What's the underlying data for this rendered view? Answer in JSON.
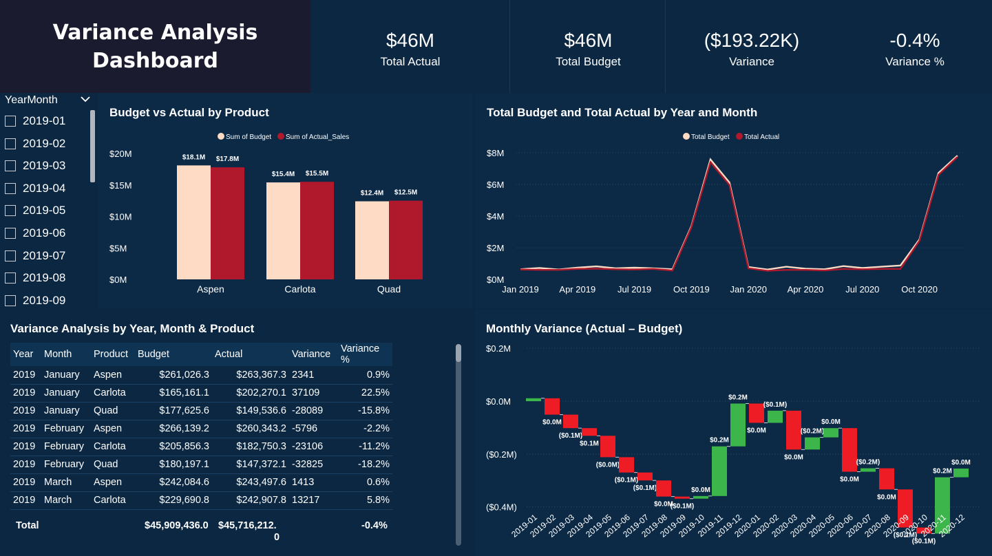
{
  "dashboard": {
    "title_line1": "Variance Analysis",
    "title_line2": "Dashboard"
  },
  "kpis": [
    {
      "value": "$46M",
      "label": "Total Actual"
    },
    {
      "value": "$46M",
      "label": "Total Budget"
    },
    {
      "value": "($193.22K)",
      "label": "Variance"
    },
    {
      "value": "-0.4%",
      "label": "Variance %"
    }
  ],
  "slicer": {
    "header": "YearMonth",
    "items": [
      "2019-01",
      "2019-02",
      "2019-03",
      "2019-04",
      "2019-05",
      "2019-06",
      "2019-07",
      "2019-08",
      "2019-09"
    ]
  },
  "colors": {
    "budget": "#fddbc5",
    "actual": "#b0182b",
    "increase": "#3cb54a",
    "decrease": "#ee1c25",
    "background": "#0b2742"
  },
  "bar_chart": {
    "title": "Budget vs Actual by Product",
    "chart_data": {
      "type": "bar",
      "categories": [
        "Aspen",
        "Carlota",
        "Quad"
      ],
      "series": [
        {
          "name": "Sum of Budget",
          "values": [
            18.1,
            15.4,
            12.4
          ],
          "labels": [
            "$18.1M",
            "$15.4M",
            "$12.4M"
          ]
        },
        {
          "name": "Sum of Actual_Sales",
          "values": [
            17.8,
            15.5,
            12.5
          ],
          "labels": [
            "$17.8M",
            "$15.5M",
            "$12.5M"
          ]
        }
      ],
      "yticks": [
        "$20M",
        "$15M",
        "$10M",
        "$5M",
        "$0M"
      ],
      "ylim": [
        0,
        20
      ],
      "legend": "top-center"
    }
  },
  "line_chart": {
    "title": "Total Budget and Total Actual by Year and Month",
    "chart_data": {
      "type": "line",
      "x": [
        "2019-01",
        "2019-02",
        "2019-03",
        "2019-04",
        "2019-05",
        "2019-06",
        "2019-07",
        "2019-08",
        "2019-09",
        "2019-10",
        "2019-11",
        "2019-12",
        "2020-01",
        "2020-02",
        "2020-03",
        "2020-04",
        "2020-05",
        "2020-06",
        "2020-07",
        "2020-08",
        "2020-09",
        "2020-10",
        "2020-11",
        "2020-12"
      ],
      "series": [
        {
          "name": "Total Budget",
          "values": [
            0.64,
            0.72,
            0.62,
            0.74,
            0.82,
            0.7,
            0.74,
            0.7,
            0.64,
            3.38,
            7.58,
            6.12,
            0.78,
            0.62,
            0.8,
            0.68,
            0.64,
            0.84,
            0.72,
            0.8,
            0.88,
            2.52,
            6.72,
            7.82
          ]
        },
        {
          "name": "Total Actual",
          "values": [
            0.62,
            0.6,
            0.6,
            0.66,
            0.68,
            0.64,
            0.62,
            0.66,
            0.56,
            3.3,
            7.4,
            5.96,
            0.7,
            0.54,
            0.6,
            0.6,
            0.56,
            0.66,
            0.64,
            0.66,
            0.66,
            2.44,
            6.6,
            7.74
          ]
        }
      ],
      "xticks": [
        "Jan 2019",
        "Apr 2019",
        "Jul 2019",
        "Oct 2019",
        "Jan 2020",
        "Apr 2020",
        "Jul 2020",
        "Oct 2020"
      ],
      "yticks": [
        "$8M",
        "$6M",
        "$4M",
        "$2M",
        "$0M"
      ],
      "ylim": [
        0,
        8
      ],
      "legend": "top-center"
    }
  },
  "table": {
    "title": "Variance Analysis by Year, Month & Product",
    "columns": [
      "Year",
      "Month",
      "Product",
      "Budget",
      "Actual",
      "Variance",
      "Variance %"
    ],
    "rows": [
      [
        "2019",
        "January",
        "Aspen",
        "$261,026.3",
        "$263,367.3",
        "2341",
        "0.9%"
      ],
      [
        "2019",
        "January",
        "Carlota",
        "$165,161.1",
        "$202,270.1",
        "37109",
        "22.5%"
      ],
      [
        "2019",
        "January",
        "Quad",
        "$177,625.6",
        "$149,536.6",
        "-28089",
        "-15.8%"
      ],
      [
        "2019",
        "February",
        "Aspen",
        "$266,139.2",
        "$260,343.2",
        "-5796",
        "-2.2%"
      ],
      [
        "2019",
        "February",
        "Carlota",
        "$205,856.3",
        "$182,750.3",
        "-23106",
        "-11.2%"
      ],
      [
        "2019",
        "February",
        "Quad",
        "$180,197.1",
        "$147,372.1",
        "-32825",
        "-18.2%"
      ],
      [
        "2019",
        "March",
        "Aspen",
        "$242,084.6",
        "$243,497.6",
        "1413",
        "0.6%"
      ],
      [
        "2019",
        "March",
        "Carlota",
        "$229,690.8",
        "$242,907.8",
        "13217",
        "5.8%"
      ]
    ],
    "total": {
      "label": "Total",
      "budget": "$45,909,436.0",
      "actual_line1": "$45,716,212.",
      "actual_line2": "0",
      "variance_pct": "-0.4%"
    }
  },
  "waterfall_chart": {
    "title": "Monthly Variance (Actual – Budget)",
    "chart_data": {
      "type": "bar",
      "subtype": "waterfall",
      "categories": [
        "2019-01",
        "2019-02",
        "2019-03",
        "2019-04",
        "2019-05",
        "2019-06",
        "2019-07",
        "2019-08",
        "2019-09",
        "2019-10",
        "2019-11",
        "2019-12",
        "2020-01",
        "2020-02",
        "2020-03",
        "2020-04",
        "2020-05",
        "2020-06",
        "2020-07",
        "2020-08",
        "2020-09",
        "2020-10",
        "2020-11",
        "2020-12"
      ],
      "values": [
        0.011,
        -0.062,
        -0.051,
        -0.029,
        -0.081,
        -0.058,
        -0.03,
        -0.061,
        -0.008,
        0.01,
        0.188,
        0.162,
        -0.073,
        0.046,
        -0.147,
        0.046,
        0.035,
        -0.165,
        0.013,
        -0.08,
        -0.144,
        -0.023,
        0.213,
        0.033
      ],
      "labels": [
        "$0.0M",
        "($0.1M)",
        "$0.1M",
        "($0.0M)",
        "($0.1M)",
        "($0.1M)",
        "$0.0M",
        "($0.1M)",
        "$0.0M",
        "$0.2M",
        "$0.2M",
        "$0.0M",
        "($0.1M)",
        "$0.0M",
        "($0.2M)",
        "$0.0M",
        "$0.0M",
        "($0.2M)",
        "$0.0M",
        "($0.1M)",
        "($0.1M)",
        "$0.2M",
        "$0.0M"
      ],
      "yticks": [
        "$0.2M",
        "$0.0M",
        "($0.2M)",
        "($0.4M)"
      ],
      "ylim": [
        -0.4,
        0.2
      ]
    }
  }
}
